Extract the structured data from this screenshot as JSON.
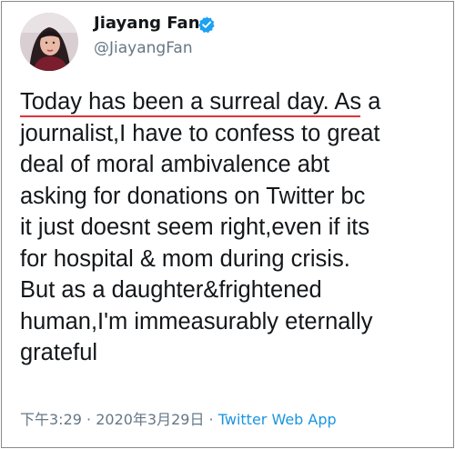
{
  "tweet": {
    "author": {
      "display_name": "Jiayang Fan",
      "handle": "@JiayangFan",
      "verified": true
    },
    "text": "Today has been a surreal day. As a\njournalist,I have to confess to great\ndeal of moral ambivalence abt\nasking for donations on Twitter bc\nit just doesnt seem right,even if its\nfor hospital & mom during crisis.\nBut as a daughter&frightened\nhuman,I'm immeasurably eternally\ngrateful",
    "time": "下午3:29",
    "separator_1": " · ",
    "date": "2020年3月29日",
    "separator_2": " · ",
    "source": "Twitter Web App"
  },
  "colors": {
    "name_text": "#14171a",
    "secondary_text": "#657786",
    "link_blue": "#1b95e0",
    "verified_badge": "#1da1f2",
    "annotation_underline": "#e0333a",
    "border": "#8a8a8a"
  },
  "icons": {
    "verified": "verified-badge-icon"
  }
}
